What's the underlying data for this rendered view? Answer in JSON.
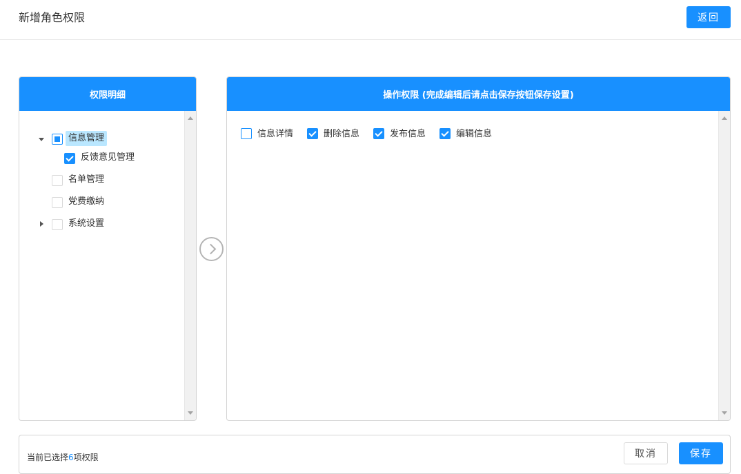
{
  "header": {
    "title": "新增角色权限",
    "back_label": "返回"
  },
  "left_panel": {
    "title": "权限明细",
    "tree": {
      "info_mgmt": {
        "label": "信息管理",
        "state": "indeterminate",
        "expanded": true,
        "selected": true
      },
      "feedback_mgmt": {
        "label": "反馈意见管理",
        "state": "checked"
      },
      "roster_mgmt": {
        "label": "名单管理",
        "state": "unchecked"
      },
      "party_fee": {
        "label": "党费缴纳",
        "state": "unchecked"
      },
      "system_settings": {
        "label": "系统设置",
        "state": "unchecked",
        "expanded": false
      }
    }
  },
  "right_panel": {
    "title": "操作权限 (完成编辑后请点击保存按钮保存设置)",
    "operations": [
      {
        "label": "信息详情",
        "checked": false
      },
      {
        "label": "删除信息",
        "checked": true
      },
      {
        "label": "发布信息",
        "checked": true
      },
      {
        "label": "编辑信息",
        "checked": true
      }
    ]
  },
  "footer": {
    "summary_prefix": "当前已选择",
    "selected_count": "6",
    "summary_suffix": "项权限",
    "cancel_label": "取消",
    "save_label": "保存"
  },
  "colors": {
    "primary": "#1890ff",
    "selected_bg": "#bae7ff",
    "border": "#d3d3d3"
  }
}
